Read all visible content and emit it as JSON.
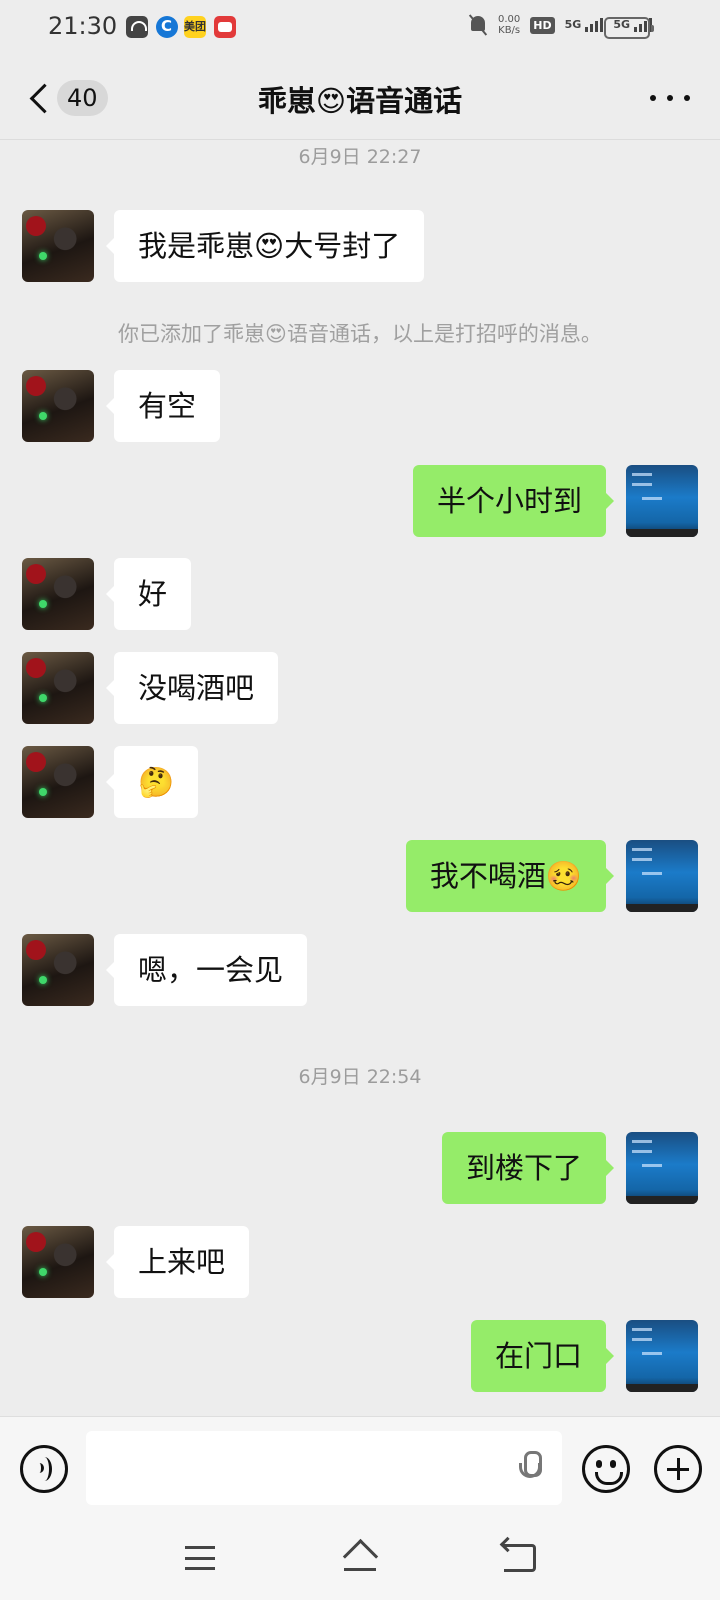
{
  "status_bar": {
    "time": "21:30",
    "net_speed_value": "0.00",
    "net_speed_unit": "KB/s",
    "hd": "HD",
    "signal1": "5G",
    "signal2": "5G"
  },
  "header": {
    "back_count": "40",
    "title": "乖崽😍语音通话",
    "more_icon": "more-dots-icon"
  },
  "messages": [
    {
      "type": "time",
      "text": "6月9日 22:27"
    },
    {
      "type": "in",
      "text": "我是乖崽😍大号封了"
    },
    {
      "type": "system",
      "text": "你已添加了乖崽😍语音通话，以上是打招呼的消息。"
    },
    {
      "type": "in",
      "text": "有空"
    },
    {
      "type": "out",
      "text": "半个小时到"
    },
    {
      "type": "in",
      "text": "好"
    },
    {
      "type": "in",
      "text": "没喝酒吧"
    },
    {
      "type": "in",
      "text": "🤔"
    },
    {
      "type": "out",
      "text": "我不喝酒🥴"
    },
    {
      "type": "in",
      "text": "嗯，一会见"
    },
    {
      "type": "time",
      "text": "6月9日 22:54"
    },
    {
      "type": "out",
      "text": "到楼下了"
    },
    {
      "type": "in",
      "text": "上来吧"
    },
    {
      "type": "out",
      "text": "在门口"
    }
  ],
  "input_bar": {
    "value": "",
    "voice_icon": "voice-mode-icon",
    "mic_icon": "microphone-icon",
    "emoji_icon": "emoji-icon",
    "plus_icon": "plus-icon"
  },
  "nav_bar": {
    "menu_icon": "menu-icon",
    "home_icon": "home-icon",
    "back_icon": "back-icon"
  }
}
